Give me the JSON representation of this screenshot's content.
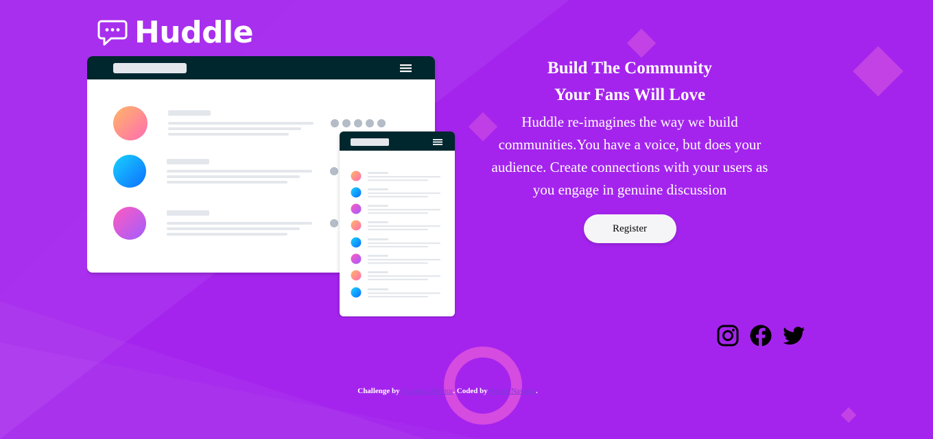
{
  "brand": {
    "name": "Huddle",
    "logo_icon": "chat-bubble-icon"
  },
  "colors": {
    "background": "#a424ed",
    "navy": "#00252e",
    "button_bg": "#f5f5f7"
  },
  "hero": {
    "title_line1": "Build The Community",
    "title_line2": "Your Fans Will Love",
    "description": "Huddle re-imagines the way we build communities.You have a voice, but does your audience. Create connections with your users as you engage in genuine discussion",
    "cta_label": "Register"
  },
  "social": [
    {
      "name": "instagram",
      "icon": "instagram-icon"
    },
    {
      "name": "facebook",
      "icon": "facebook-icon"
    },
    {
      "name": "twitter",
      "icon": "twitter-icon"
    }
  ],
  "footer": {
    "prefix": "Challenge by",
    "link1": "Frontend Mentor",
    "middle": ". Coded by",
    "link2": "Rafael Navarro",
    "suffix": "."
  }
}
